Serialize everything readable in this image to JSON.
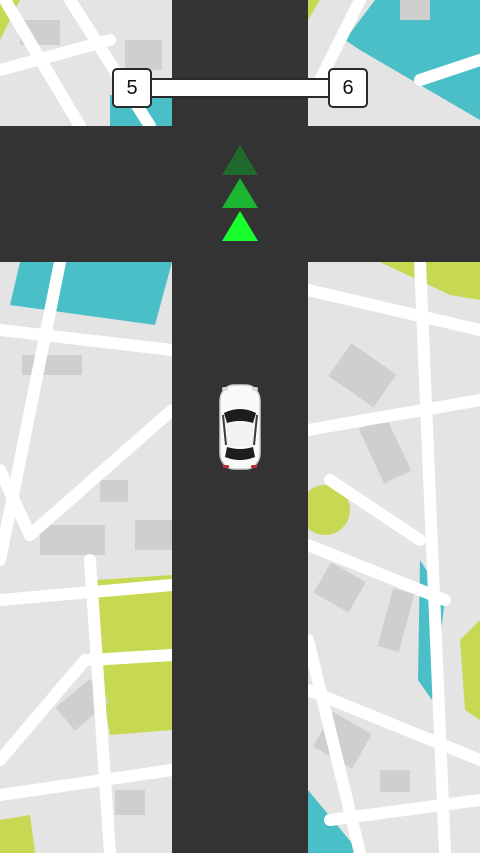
{
  "hud": {
    "current_level": "5",
    "next_level": "6",
    "level_progress": 0
  },
  "guide_arrows": {
    "direction": "up",
    "colors": [
      "#1f6b2b",
      "#1bb531",
      "#19ff2d"
    ]
  },
  "colors": {
    "road": "#333333",
    "map_block": "#e4e4e4",
    "map_street": "#ffffff",
    "park": "#c7d952",
    "water": "#4bbfc8",
    "building": "#cfcfcf"
  },
  "player": {
    "vehicle": "white-car-icon",
    "heading": "up"
  }
}
